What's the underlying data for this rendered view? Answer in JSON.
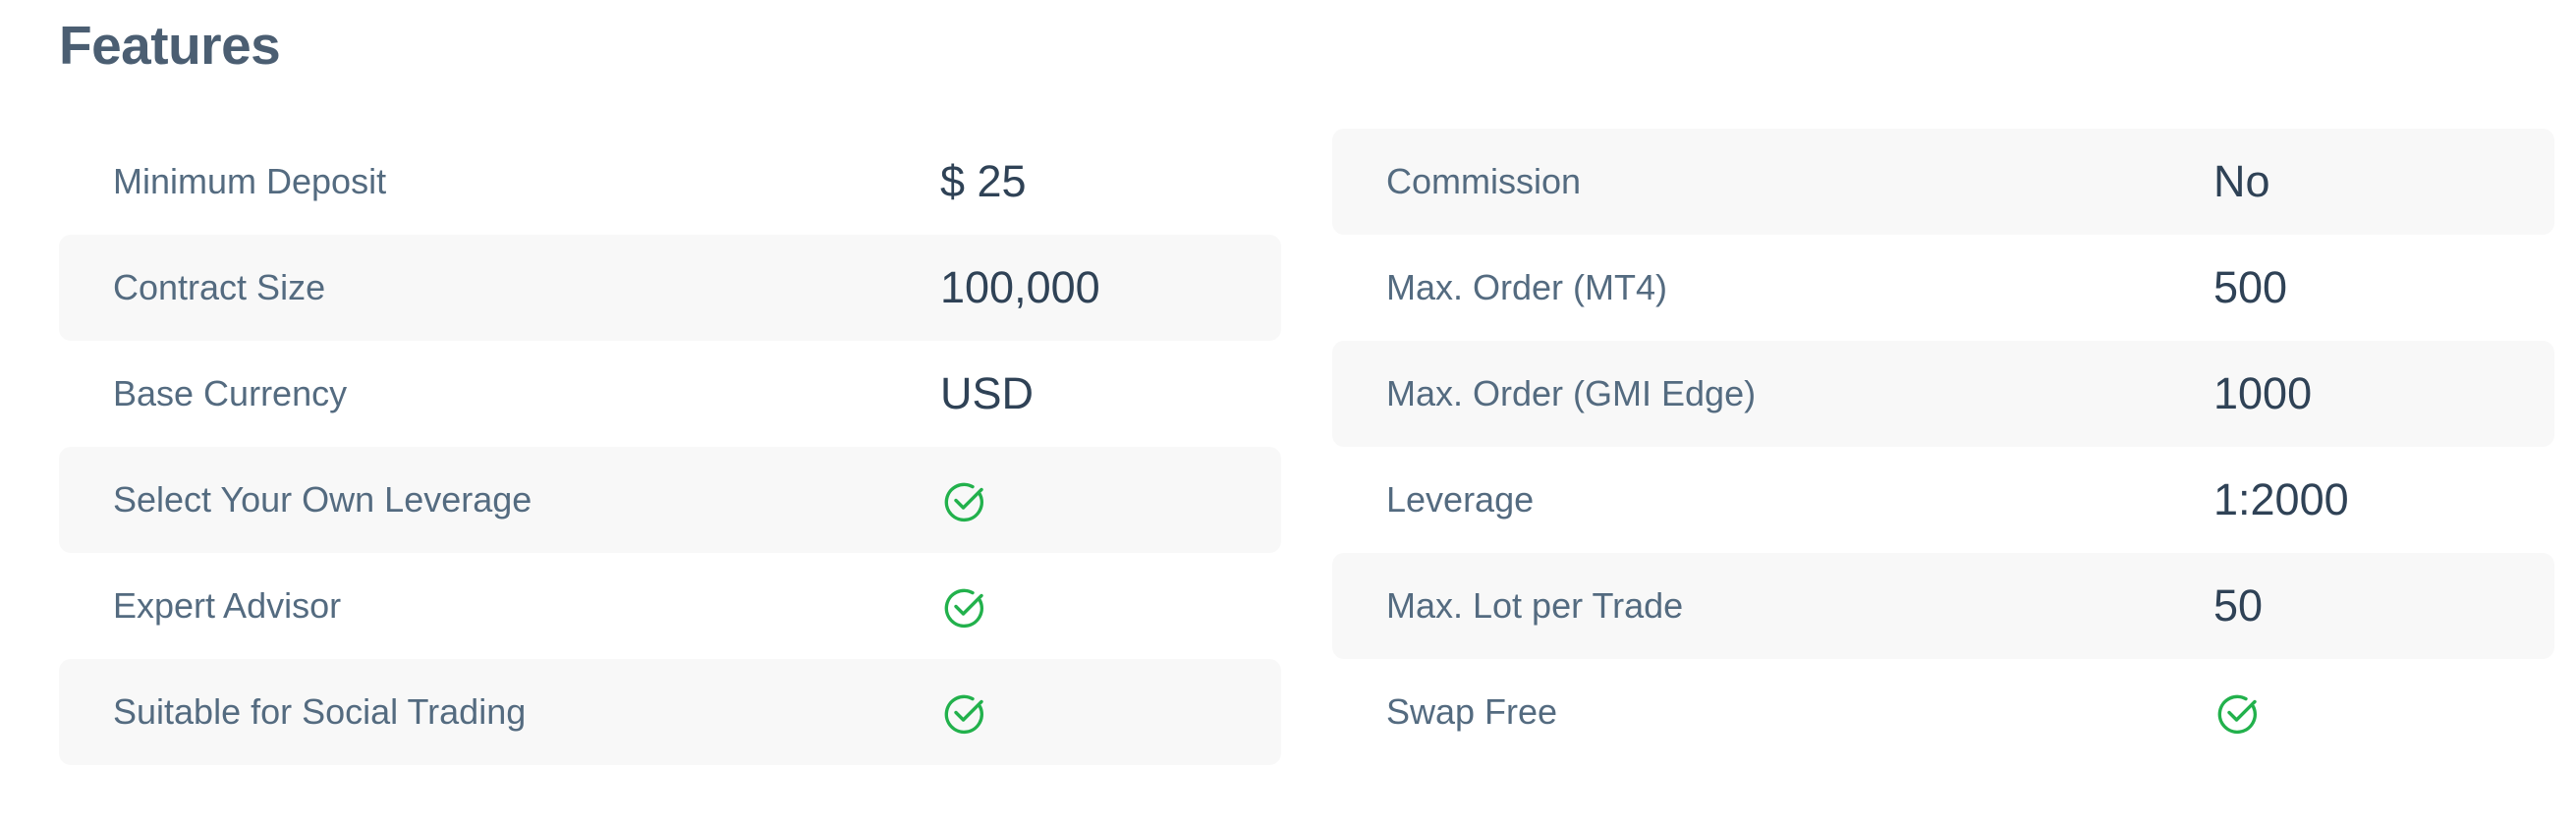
{
  "header": {
    "title": "Features"
  },
  "colors": {
    "check": "#22b14c",
    "text": "#546b80",
    "value": "#2f4256",
    "shade": "#f8f8f8"
  },
  "left_features": [
    {
      "label": "Minimum Deposit",
      "value": "$ 25"
    },
    {
      "label": "Contract Size",
      "value": "100,000"
    },
    {
      "label": "Base Currency",
      "value": "USD"
    },
    {
      "label": "Select Your Own Leverage",
      "icon": "check-circle-icon"
    },
    {
      "label": "Expert Advisor",
      "icon": "check-circle-icon"
    },
    {
      "label": "Suitable for Social Trading",
      "icon": "check-circle-icon"
    }
  ],
  "right_features": [
    {
      "label": "Commission",
      "value": "No"
    },
    {
      "label": "Max. Order (MT4)",
      "value": "500"
    },
    {
      "label": "Max. Order (GMI Edge)",
      "value": "1000"
    },
    {
      "label": "Leverage",
      "value": "1:2000"
    },
    {
      "label": "Max. Lot per Trade",
      "value": "50"
    },
    {
      "label": "Swap Free",
      "icon": "check-circle-icon"
    }
  ]
}
